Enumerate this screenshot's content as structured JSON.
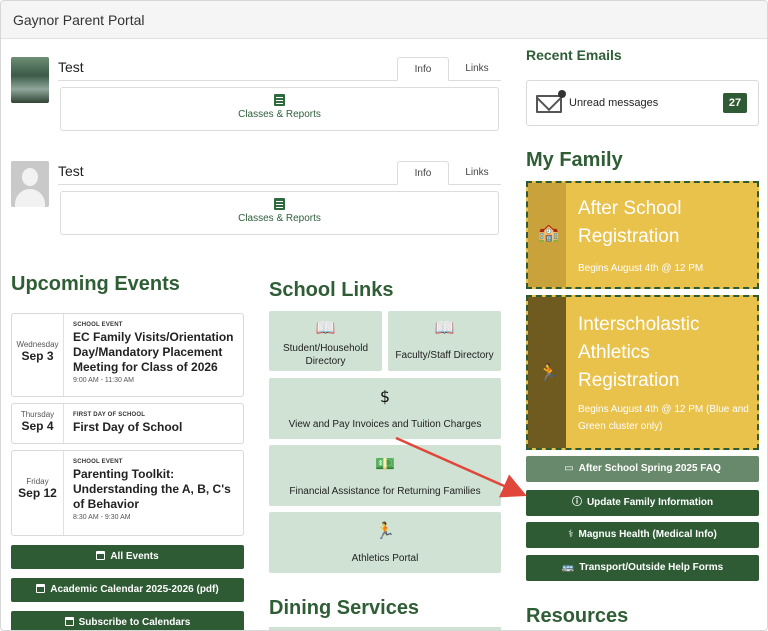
{
  "window": {
    "title": "Gaynor Parent Portal"
  },
  "students": [
    {
      "name": "Test",
      "tabs": [
        "Info",
        "Links"
      ],
      "panel_label": "Classes & Reports"
    },
    {
      "name": "Test",
      "tabs": [
        "Info",
        "Links"
      ],
      "panel_label": "Classes & Reports"
    }
  ],
  "events": {
    "heading": "Upcoming Events",
    "items": [
      {
        "dow": "Wednesday",
        "day": "Sep 3",
        "kind": "SCHOOL EVENT",
        "title": "EC Family Visits/Orientation Day/Mandatory Placement Meeting for Class of 2026",
        "time": "9:00 AM - 11:30 AM"
      },
      {
        "dow": "Thursday",
        "day": "Sep 4",
        "kind": "FIRST DAY OF SCHOOL",
        "title": "First Day of School",
        "time": ""
      },
      {
        "dow": "Friday",
        "day": "Sep 12",
        "kind": "SCHOOL EVENT",
        "title": "Parenting Toolkit: Understanding the A, B, C's of Behavior",
        "time": "8:30 AM - 9:30 AM"
      }
    ],
    "buttons": [
      "All Events",
      "Academic Calendar 2025-2026 (pdf)",
      "Subscribe to Calendars"
    ]
  },
  "school_links": {
    "heading": "School Links",
    "tiles": [
      {
        "icon": "book-icon",
        "label": "Student/Household Directory"
      },
      {
        "icon": "book-icon",
        "label": "Faculty/Staff Directory"
      },
      {
        "icon": "invoice-folder-icon",
        "label": "View and Pay Invoices and Tuition Charges"
      },
      {
        "icon": "money-icon",
        "label": "Financial Assistance for Returning Families"
      },
      {
        "icon": "runner-icon",
        "label": "Athletics Portal"
      }
    ]
  },
  "dining": {
    "heading": "Dining Services"
  },
  "emails": {
    "heading": "Recent Emails",
    "label": "Unread messages",
    "count": "27"
  },
  "family": {
    "heading": "My Family",
    "cards": [
      {
        "title": "After School Registration",
        "subtitle": "Begins August 4th @ 12 PM",
        "icon": "school-icon"
      },
      {
        "title": "Interscholastic Athletics Registration",
        "subtitle": "Begins August 4th @ 12 PM (Blue and Green cluster only)",
        "icon": "runner-icon"
      }
    ],
    "buttons": [
      {
        "label": "After School Spring 2025 FAQ",
        "icon": "id-card-icon"
      },
      {
        "label": "Update Family Information",
        "icon": "info-icon"
      },
      {
        "label": "Magnus Health (Medical Info)",
        "icon": "stethoscope-icon"
      },
      {
        "label": "Transport/Outside Help Forms",
        "icon": "bus-icon"
      }
    ]
  },
  "resources": {
    "heading": "Resources"
  },
  "colors": {
    "brand_green": "#2e5b34",
    "tile_green": "#cfe2d3",
    "card_yellow": "#e9c24c",
    "annotation_arrow": "#e0473a"
  }
}
